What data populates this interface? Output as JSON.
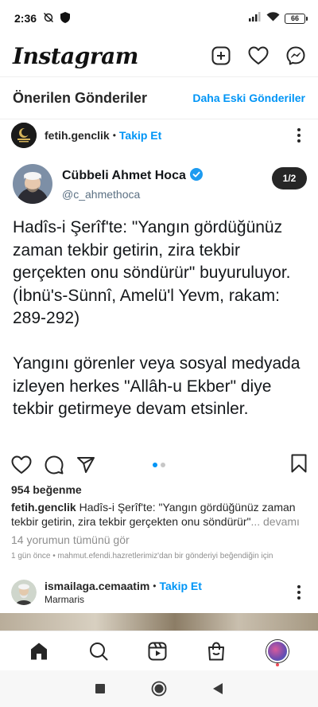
{
  "status_bar": {
    "time": "2:36",
    "battery": "66"
  },
  "app": {
    "title": "Instagram",
    "icons": [
      "new-post-icon",
      "heart-icon",
      "messenger-icon"
    ]
  },
  "suggested": {
    "title": "Önerilen Gönderiler",
    "older_link": "Daha Eski Gönderiler"
  },
  "post": {
    "username": "fetih.genclik",
    "separator": "•",
    "follow_label": "Takip Et",
    "media": {
      "tweet_name": "Cübbeli Ahmet Hoca",
      "tweet_handle": "@c_ahmethoca",
      "counter": "1/2",
      "tweet_text": "Hadîs-i Şerîf'te: \"Yangın gördüğünüz zaman tekbir getirin, zira tekbir gerçekten onu söndürür\" buyuruluyor. (İbnü's-Sünnî, Amelü'l Yevm, rakam: 289-292)\n\nYangını görenler veya sosyal medyada izleyen herkes \"Allâh-u Ekber\" diye tekbir getirmeye devam etsinler."
    },
    "likes": "954 beğenme",
    "caption_user": "fetih.genclik",
    "caption_text": "Hadîs-i Şerîf'te: \"Yangın gördüğünüz zaman tekbir getirin, zira tekbir gerçekten onu söndürür\"",
    "caption_more": "... devamı",
    "comments_link": "14 yorumun tümünü gör",
    "meta": "1 gün önce • mahmut.efendi.hazretlerimiz'dan bir gönderiyi beğendiğin için"
  },
  "next_post": {
    "username": "ismailaga.cemaatim",
    "separator": "•",
    "follow_label": "Takip Et",
    "location": "Marmaris"
  },
  "colors": {
    "accent": "#0095f6",
    "text": "#262626",
    "muted": "#8e8e8e",
    "verified": "#1d9bf0"
  }
}
